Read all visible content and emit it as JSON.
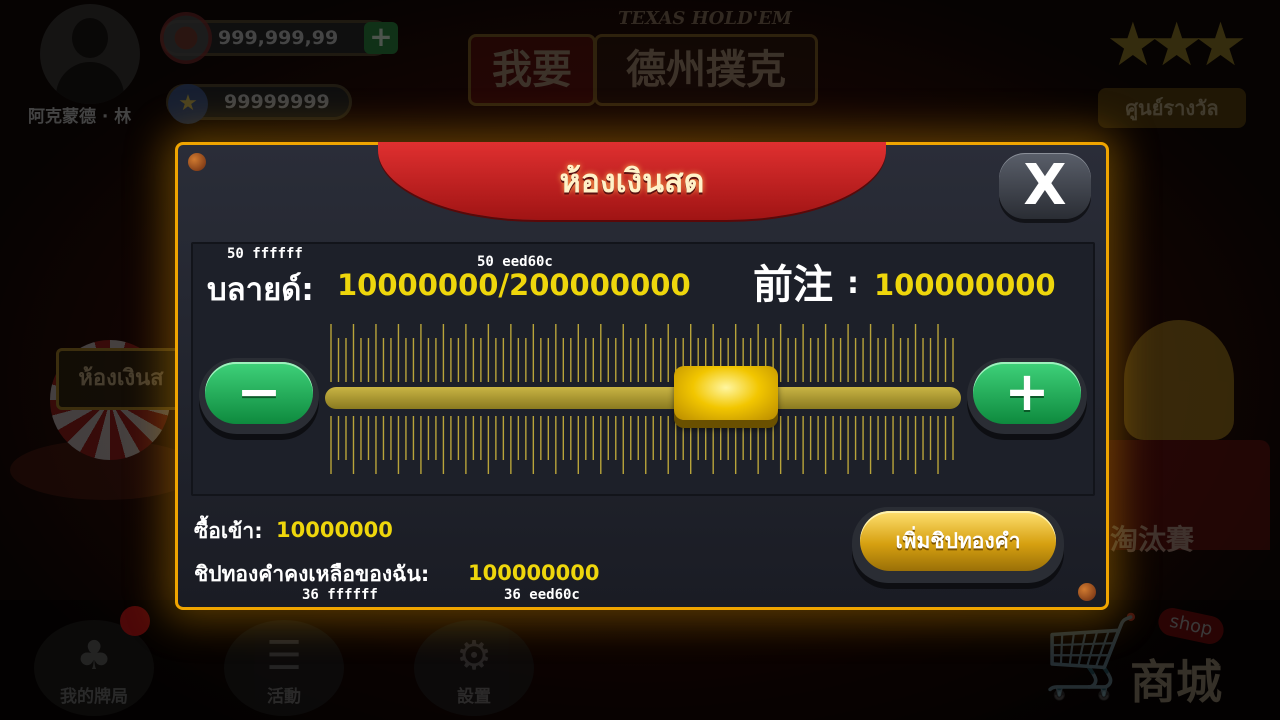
{
  "background": {
    "player_name": "阿克蒙德 · 林",
    "chips_balance": "999,999,99",
    "gold_balance": "99999999",
    "logo_en": "TEXAS HOLD'EM",
    "logo_zh_left": "我要",
    "logo_zh_right": "德州撲克",
    "reward_center_label": "ศูนย์รางวัล",
    "left_side_label": "ห้องเงินส",
    "right_side_label": "淘汰賽",
    "bottom_nav": [
      {
        "label": "我的牌局",
        "icon": "cards-icon"
      },
      {
        "label": "活動",
        "icon": "list-icon"
      },
      {
        "label": "設置",
        "icon": "gear-icon"
      }
    ],
    "shop_tag": "shop",
    "shop_label": "商城"
  },
  "modal": {
    "title": "ห้องเงินสด",
    "close_symbol": "X",
    "blinds_label": "บลายด์:",
    "blinds_value": "10000000/200000000",
    "ante_label": "前注",
    "ante_colon": ":",
    "ante_value": "100000000",
    "annot_blinds_label": "50  ffffff",
    "annot_blinds_value": "50  eed60c",
    "annot_rem_label": "36  ffffff",
    "annot_rem_value": "36  eed60c",
    "slider": {
      "value_fraction": 0.63
    },
    "minus_symbol": "−",
    "plus_symbol": "+",
    "buyin_label": "ซื้อเข้า:",
    "buyin_value": "10000000",
    "remaining_label": "ชิปทองคำคงเหลือของฉัน:",
    "remaining_value": "100000000",
    "add_gold_button": "เพิ่มชิปทองคำ"
  },
  "colors": {
    "accent_gold": "#eed60c",
    "text_white": "#ffffff",
    "frame_orange": "#f0a500",
    "banner_red": "#d02020",
    "button_green": "#1faa55"
  }
}
